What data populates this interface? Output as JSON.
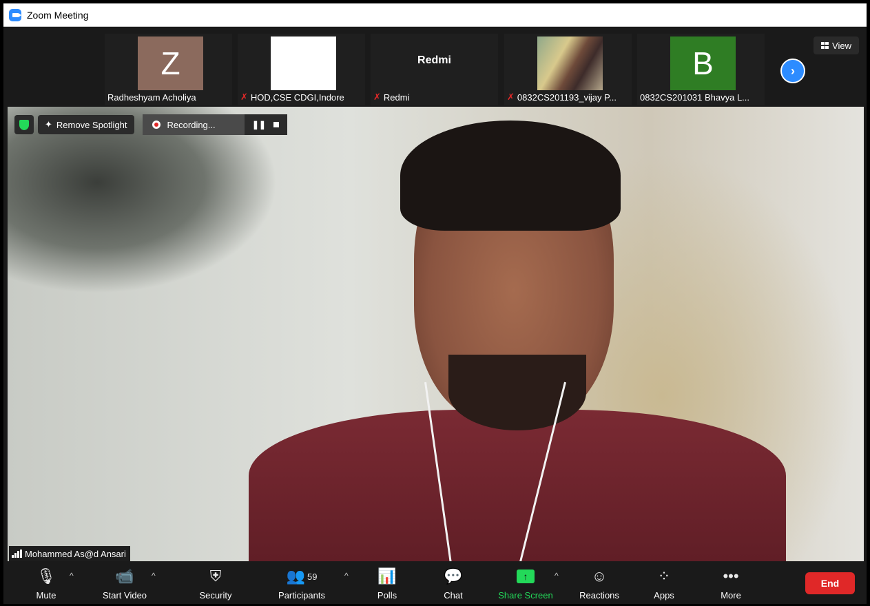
{
  "window": {
    "title": "Zoom Meeting"
  },
  "strip": {
    "participants": [
      {
        "initial": "Z",
        "tile_color": "#8b6a5d",
        "name": "Radheshyam Acholiya",
        "muted": false
      },
      {
        "initial": "",
        "tile_color": "#ffffff",
        "name": "HOD,CSE CDGI,Indore",
        "muted": true
      },
      {
        "label": "Redmi",
        "name": "Redmi",
        "muted": true
      },
      {
        "photo": true,
        "name": "0832CS201193_vijay P...",
        "muted": true
      },
      {
        "initial": "B",
        "tile_color": "#2f7d24",
        "name": "0832CS201031 Bhavya L...",
        "muted": false
      }
    ],
    "view_label": "View"
  },
  "overlay": {
    "remove_spotlight": "Remove Spotlight",
    "recording": "Recording...",
    "pause_glyph": "❚❚"
  },
  "speaker": {
    "name": "Mohammed As@d Ansari"
  },
  "toolbar": {
    "mute": "Mute",
    "start_video": "Start Video",
    "security": "Security",
    "participants": "Participants",
    "participants_count": "59",
    "polls": "Polls",
    "chat": "Chat",
    "share_screen": "Share Screen",
    "reactions": "Reactions",
    "apps": "Apps",
    "more": "More",
    "end": "End"
  },
  "colors": {
    "accent": "#2d8cff",
    "green": "#23d959",
    "end": "#e02828"
  }
}
